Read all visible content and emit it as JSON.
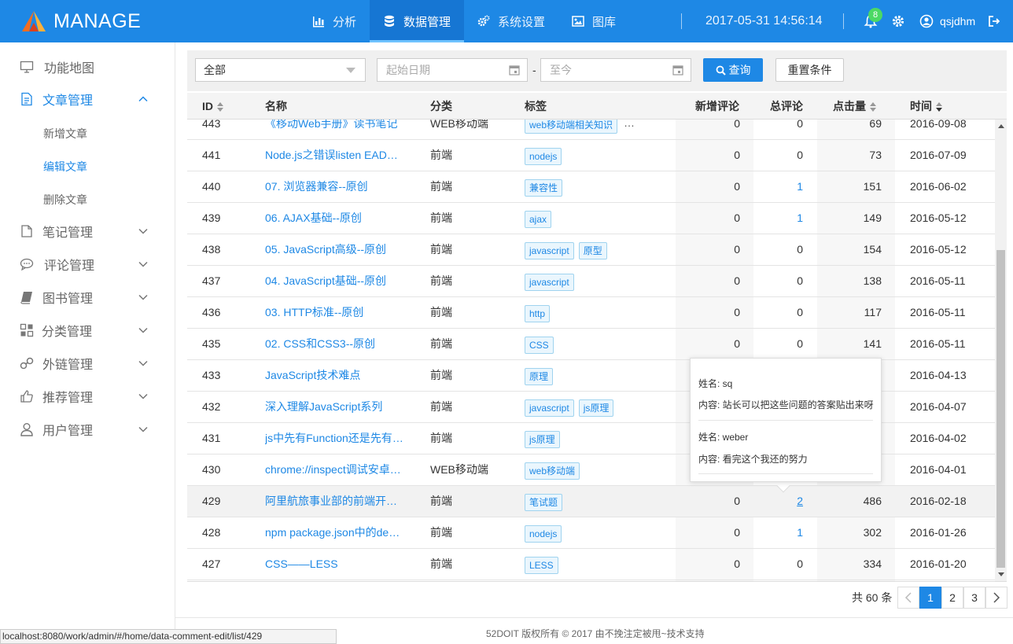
{
  "app": {
    "logo_text": "MANAGE"
  },
  "nav": [
    {
      "label": "分析",
      "icon": "bar-chart-icon"
    },
    {
      "label": "数据管理",
      "icon": "database-icon"
    },
    {
      "label": "系统设置",
      "icon": "gears-icon"
    },
    {
      "label": "图库",
      "icon": "image-icon"
    }
  ],
  "header": {
    "datetime": "2017-05-31 14:56:14",
    "notifications": "8",
    "username": "qsjdhm"
  },
  "sidebar": {
    "items": [
      {
        "label": "功能地图",
        "icon": "desktop-icon"
      },
      {
        "label": "文章管理",
        "icon": "document-icon"
      },
      {
        "label": "笔记管理",
        "icon": "note-icon"
      },
      {
        "label": "评论管理",
        "icon": "comment-icon"
      },
      {
        "label": "图书管理",
        "icon": "book-icon"
      },
      {
        "label": "分类管理",
        "icon": "category-icon"
      },
      {
        "label": "外链管理",
        "icon": "link-icon"
      },
      {
        "label": "推荐管理",
        "icon": "thumbs-up-icon"
      },
      {
        "label": "用户管理",
        "icon": "user-icon"
      }
    ],
    "subitems": [
      "新增文章",
      "编辑文章",
      "删除文章"
    ]
  },
  "filter": {
    "category_value": "全部",
    "start_placeholder": "起始日期",
    "end_placeholder": "至今",
    "dash": "-",
    "query_label": "查询",
    "reset_label": "重置条件"
  },
  "table": {
    "headers": {
      "id": "ID",
      "name": "名称",
      "category": "分类",
      "tags": "标签",
      "new_comments": "新增评论",
      "total_comments": "总评论",
      "clicks": "点击量",
      "time": "时间"
    },
    "rows": [
      {
        "id": "443",
        "name": "《移动Web手册》读书笔记",
        "category": "WEB移动端",
        "tags": [
          "web移动端相关知识"
        ],
        "more": "…",
        "new": "0",
        "total": "0",
        "clicks": "69",
        "time": "2016-09-08"
      },
      {
        "id": "441",
        "name": "Node.js之错误listen EADDRINUSE",
        "category": "前端",
        "tags": [
          "nodejs"
        ],
        "new": "0",
        "total": "0",
        "clicks": "73",
        "time": "2016-07-09"
      },
      {
        "id": "440",
        "name": "07. 浏览器兼容--原创",
        "category": "前端",
        "tags": [
          "兼容性"
        ],
        "new": "0",
        "total": "1",
        "clicks": "151",
        "time": "2016-06-02"
      },
      {
        "id": "439",
        "name": "06. AJAX基础--原创",
        "category": "前端",
        "tags": [
          "ajax"
        ],
        "new": "0",
        "total": "1",
        "clicks": "149",
        "time": "2016-05-12"
      },
      {
        "id": "438",
        "name": "05. JavaScript高级--原创",
        "category": "前端",
        "tags": [
          "javascript",
          "原型"
        ],
        "new": "0",
        "total": "0",
        "clicks": "154",
        "time": "2016-05-12"
      },
      {
        "id": "437",
        "name": "04. JavaScript基础--原创",
        "category": "前端",
        "tags": [
          "javascript"
        ],
        "new": "0",
        "total": "0",
        "clicks": "138",
        "time": "2016-05-11"
      },
      {
        "id": "436",
        "name": "03. HTTP标准--原创",
        "category": "前端",
        "tags": [
          "http"
        ],
        "new": "0",
        "total": "0",
        "clicks": "117",
        "time": "2016-05-11"
      },
      {
        "id": "435",
        "name": "02. CSS和CSS3--原创",
        "category": "前端",
        "tags": [
          "CSS"
        ],
        "new": "0",
        "total": "0",
        "clicks": "141",
        "time": "2016-05-11"
      },
      {
        "id": "433",
        "name": "JavaScript技术难点",
        "category": "前端",
        "tags": [
          "原理"
        ],
        "new": "",
        "total": "",
        "clicks": "",
        "time": "2016-04-13"
      },
      {
        "id": "432",
        "name": "深入理解JavaScript系列",
        "category": "前端",
        "tags": [
          "javascript",
          "js原理"
        ],
        "new": "",
        "total": "",
        "clicks": "",
        "time": "2016-04-07"
      },
      {
        "id": "431",
        "name": "js中先有Function还是先有Object",
        "category": "前端",
        "tags": [
          "js原理"
        ],
        "new": "",
        "total": "",
        "clicks": "",
        "time": "2016-04-02"
      },
      {
        "id": "430",
        "name": "chrome://inspect调试安卓手机",
        "category": "WEB移动端",
        "tags": [
          "web移动端"
        ],
        "new": "",
        "total": "",
        "clicks": "",
        "time": "2016-04-01"
      },
      {
        "id": "429",
        "name": "阿里航旅事业部的前端开发面试",
        "category": "前端",
        "tags": [
          "笔试题"
        ],
        "new": "0",
        "total": "2",
        "clicks": "486",
        "time": "2016-02-18"
      },
      {
        "id": "428",
        "name": "npm package.json中的dependencies",
        "category": "前端",
        "tags": [
          "nodejs"
        ],
        "new": "0",
        "total": "1",
        "clicks": "302",
        "time": "2016-01-26"
      },
      {
        "id": "427",
        "name": "CSS——LESS",
        "category": "前端",
        "tags": [
          "LESS"
        ],
        "new": "0",
        "total": "0",
        "clicks": "334",
        "time": "2016-01-20"
      }
    ]
  },
  "popover": [
    {
      "name": "姓名: sq",
      "content": "内容: 站长可以把这些问题的答案贴出来呀"
    },
    {
      "name": "姓名: weber",
      "content": "内容: 看完这个我还的努力"
    }
  ],
  "pagination": {
    "total": "共 60 条",
    "pages": [
      "1",
      "2",
      "3"
    ]
  },
  "footer": {
    "text": "52DOIT 版权所有 © 2017 由不挽注定被甩~技术支持"
  },
  "statusbar": {
    "url": "localhost:8080/work/admin/#/home/data-comment-edit/list/429"
  },
  "colors": {
    "primary": "#1e88e5",
    "header_bg": "#1e88e5",
    "badge": "#4cd964"
  }
}
